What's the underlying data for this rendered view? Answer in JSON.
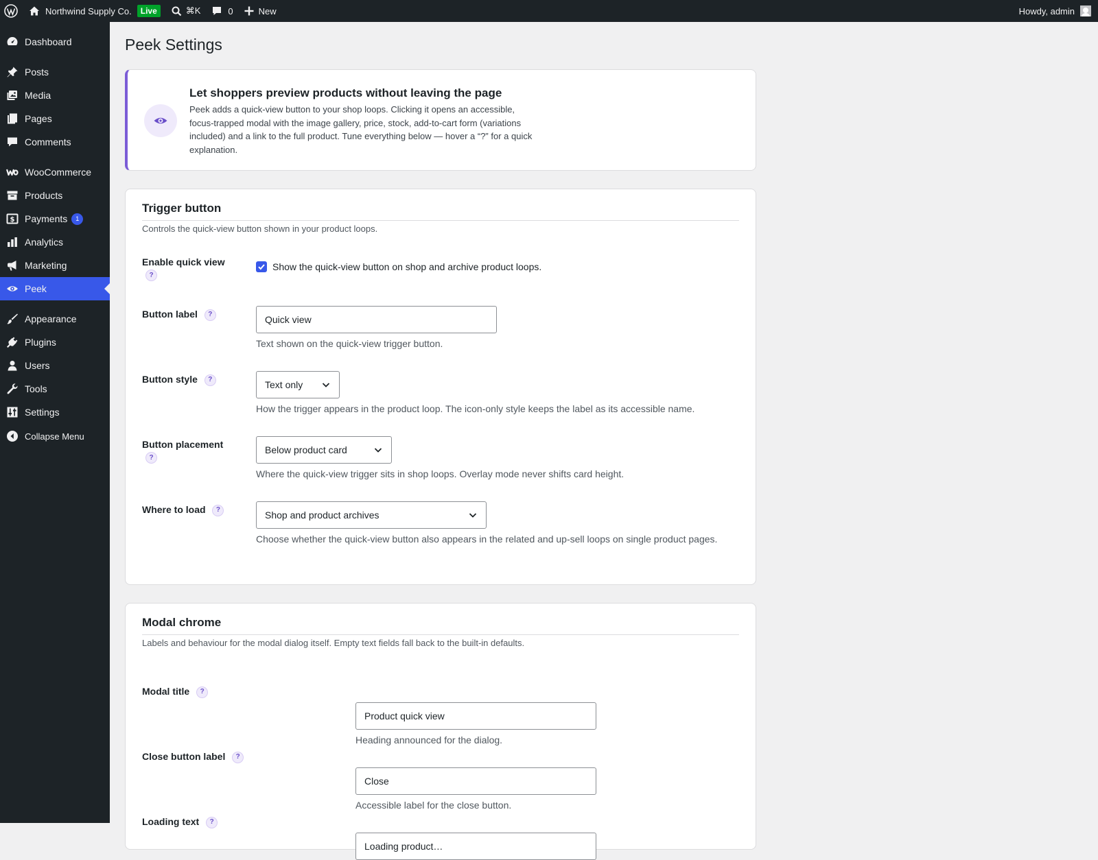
{
  "adminbar": {
    "site_name": "Northwind Supply Co.",
    "live_badge": "Live",
    "search_shortcut": "⌘K",
    "comments_count": "0",
    "new_label": "New",
    "howdy": "Howdy, admin"
  },
  "sidebar": {
    "items": [
      {
        "label": "Dashboard",
        "icon": "dashboard-icon"
      },
      {
        "label": "Posts",
        "icon": "pushpin-icon"
      },
      {
        "label": "Media",
        "icon": "media-icon"
      },
      {
        "label": "Pages",
        "icon": "pages-icon"
      },
      {
        "label": "Comments",
        "icon": "comment-icon"
      },
      {
        "label": "WooCommerce",
        "icon": "woo-icon"
      },
      {
        "label": "Products",
        "icon": "archive-icon"
      },
      {
        "label": "Payments",
        "icon": "payments-icon",
        "badge": "1"
      },
      {
        "label": "Analytics",
        "icon": "bar-chart-icon"
      },
      {
        "label": "Marketing",
        "icon": "megaphone-icon"
      },
      {
        "label": "Peek",
        "icon": "eye-icon",
        "current": true
      },
      {
        "label": "Appearance",
        "icon": "brush-icon"
      },
      {
        "label": "Plugins",
        "icon": "plug-icon"
      },
      {
        "label": "Users",
        "icon": "user-icon"
      },
      {
        "label": "Tools",
        "icon": "wrench-icon"
      },
      {
        "label": "Settings",
        "icon": "sliders-icon"
      }
    ],
    "collapse_label": "Collapse Menu"
  },
  "page": {
    "title": "Peek Settings"
  },
  "intro": {
    "title": "Let shoppers preview products without leaving the page",
    "text": "Peek adds a quick-view button to your shop loops. Clicking it opens an accessible, focus-trapped modal with the image gallery, price, stock, add-to-cart form (variations included) and a link to the full product. Tune everything below — hover a “?” for a quick explanation."
  },
  "trigger": {
    "title": "Trigger button",
    "desc": "Controls the quick-view button shown in your product loops.",
    "enable_label": "Enable quick view",
    "enable_checkbox_text": "Show the quick-view button on shop and archive product loops.",
    "enable_checked": true,
    "button_label_label": "Button label",
    "button_label_value": "Quick view",
    "button_label_hint": "Text shown on the quick-view trigger button.",
    "button_style_label": "Button style",
    "button_style_value": "Text only",
    "button_style_hint": "How the trigger appears in the product loop. The icon-only style keeps the label as its accessible name.",
    "placement_label": "Button placement",
    "placement_value": "Below product card",
    "placement_hint": "Where the quick-view trigger sits in shop loops. Overlay mode never shifts card height.",
    "where_label": "Where to load",
    "where_value": "Shop and product archives",
    "where_hint": "Choose whether the quick-view button also appears in the related and up-sell loops on single product pages."
  },
  "modal": {
    "title": "Modal chrome",
    "desc": "Labels and behaviour for the modal dialog itself. Empty text fields fall back to the built-in defaults.",
    "modal_title_label": "Modal title",
    "modal_title_value": "Product quick view",
    "modal_title_hint": "Heading announced for the dialog.",
    "close_label": "Close button label",
    "close_value": "Close",
    "close_hint": "Accessible label for the close button.",
    "loading_label": "Loading text",
    "loading_value": "Loading product…"
  },
  "help_glyph": "?",
  "colors": {
    "accent": "#3858e9",
    "purple": "#7b5cd6",
    "adminbar_bg": "#1d2327",
    "live_green": "#00a32a"
  }
}
